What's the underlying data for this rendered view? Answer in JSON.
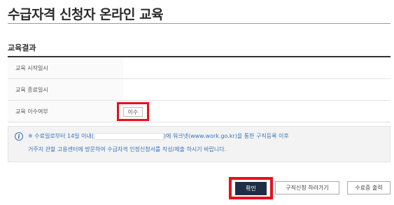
{
  "page": {
    "title": "수급자격 신청자 온라인 교육"
  },
  "section": {
    "title": "교육결과"
  },
  "rows": [
    {
      "label": "교육 시작일시",
      "value": ""
    },
    {
      "label": "교육 종료일시",
      "value": ""
    },
    {
      "label": "교육 이수여부",
      "status": "이수"
    }
  ],
  "notice": {
    "line1_prefix": "※ 수료일로부터 14일 이내(",
    "line1_suffix": ")에 워크넷(www.work.go.kr)을 통한 구직등록 이후",
    "line2": "거주지 관할 고용센터에 방문하여 수급자격 인정신청서를 작성/제출 하시기 바랍니다.",
    "icon": "info-icon"
  },
  "buttons": {
    "confirm": "확인",
    "job_apply": "구직신청 하러가기",
    "certificate": "수료증 출력"
  },
  "colors": {
    "highlight": "#e8101a",
    "primary_button": "#1f2e45",
    "notice_text": "#3a73b8"
  }
}
